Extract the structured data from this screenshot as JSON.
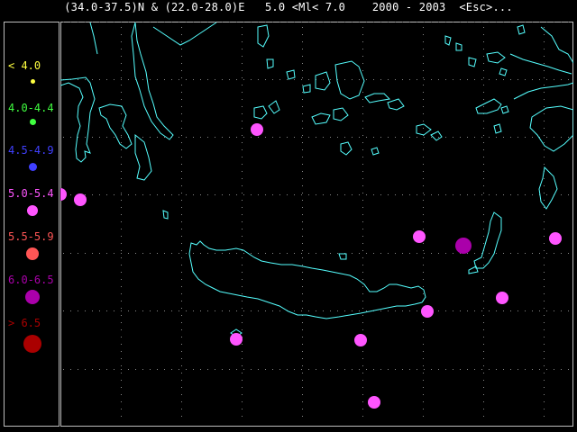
{
  "header": {
    "region": "(34.0-37.5)N & (22.0-28.0)E",
    "magnitude": "5.0 <Ml< 7.0",
    "years": "2000 - 2003",
    "esc": "<Esc>..."
  },
  "legend": [
    {
      "label": "< 4.0",
      "color": "#ffff40"
    },
    {
      "label": "4.0-4.4",
      "color": "#40ff40"
    },
    {
      "label": "4.5-4.9",
      "color": "#4040ff"
    },
    {
      "label": "5.0-5.4",
      "color": "#ff55ff"
    },
    {
      "label": "5.5-5.9",
      "color": "#ff5555"
    },
    {
      "label": "6.0-6.5",
      "color": "#aa00aa"
    },
    {
      "label": "> 6.5",
      "color": "#aa0000"
    }
  ],
  "colors": {
    "coast": "#55ffff",
    "grid": "#888888",
    "frame": "#bdbdbd"
  }
}
